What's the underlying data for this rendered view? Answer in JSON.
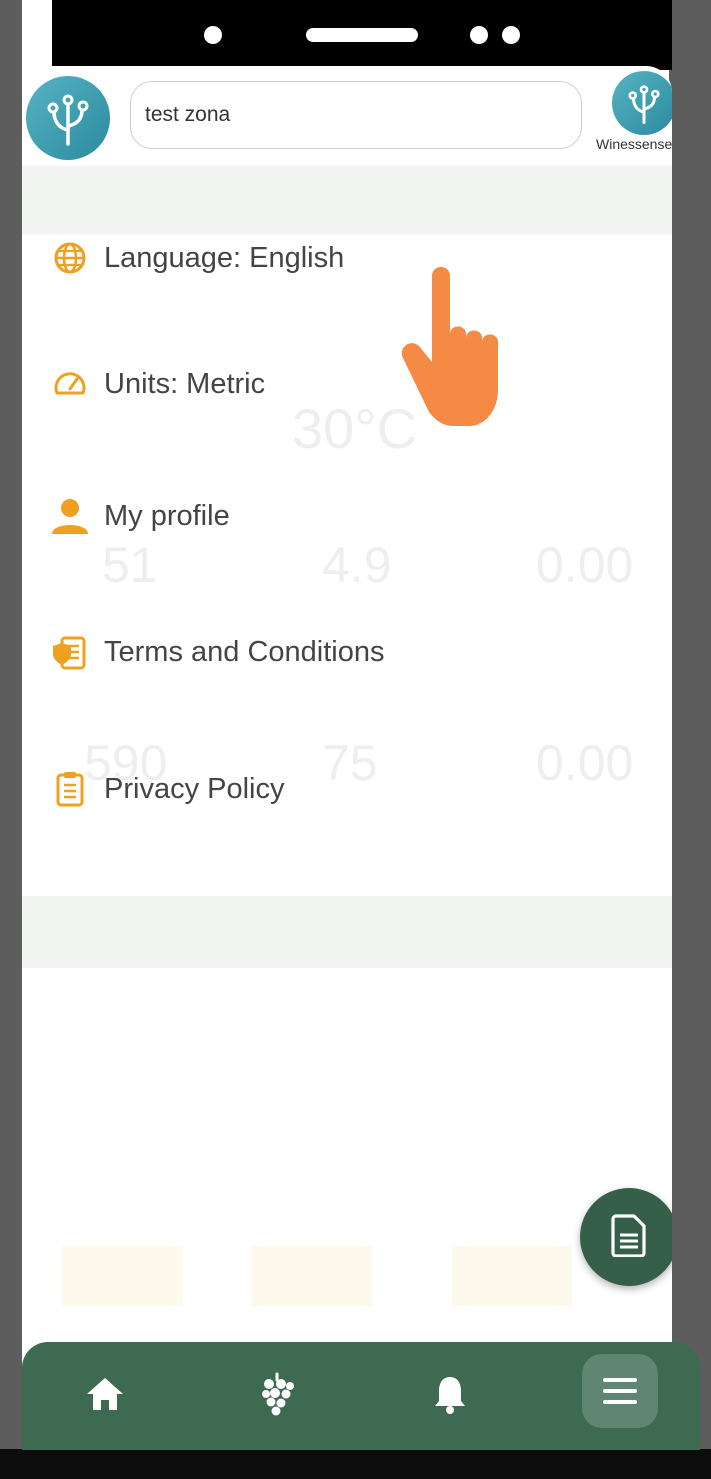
{
  "header": {
    "search_value": "test zona",
    "brand_name": "Winessense"
  },
  "menu": {
    "items": [
      {
        "label": "Language: English",
        "icon": "globe-icon"
      },
      {
        "label": "Units: Metric",
        "icon": "speedometer-icon"
      },
      {
        "label": "My profile",
        "icon": "person-icon"
      },
      {
        "label": "Terms and Conditions",
        "icon": "document-shield-icon"
      },
      {
        "label": "Privacy Policy",
        "icon": "clipboard-icon"
      }
    ]
  },
  "background_app": {
    "temperature": "30°C",
    "values": [
      "51",
      "4.9",
      "0.00",
      "590",
      "75",
      "0.00"
    ]
  },
  "fab": {
    "icon": "report-document-icon"
  },
  "bottom_nav": {
    "items": [
      {
        "icon": "home-icon"
      },
      {
        "icon": "grapes-icon"
      },
      {
        "icon": "bell-icon"
      },
      {
        "icon": "menu-icon",
        "active": true
      }
    ]
  },
  "colors": {
    "accent": "#f0a020",
    "nav_green": "#3f6a52",
    "fab_green": "#355f48",
    "logo_teal": "#3fa0b2",
    "pointer_orange": "#f58a45"
  }
}
